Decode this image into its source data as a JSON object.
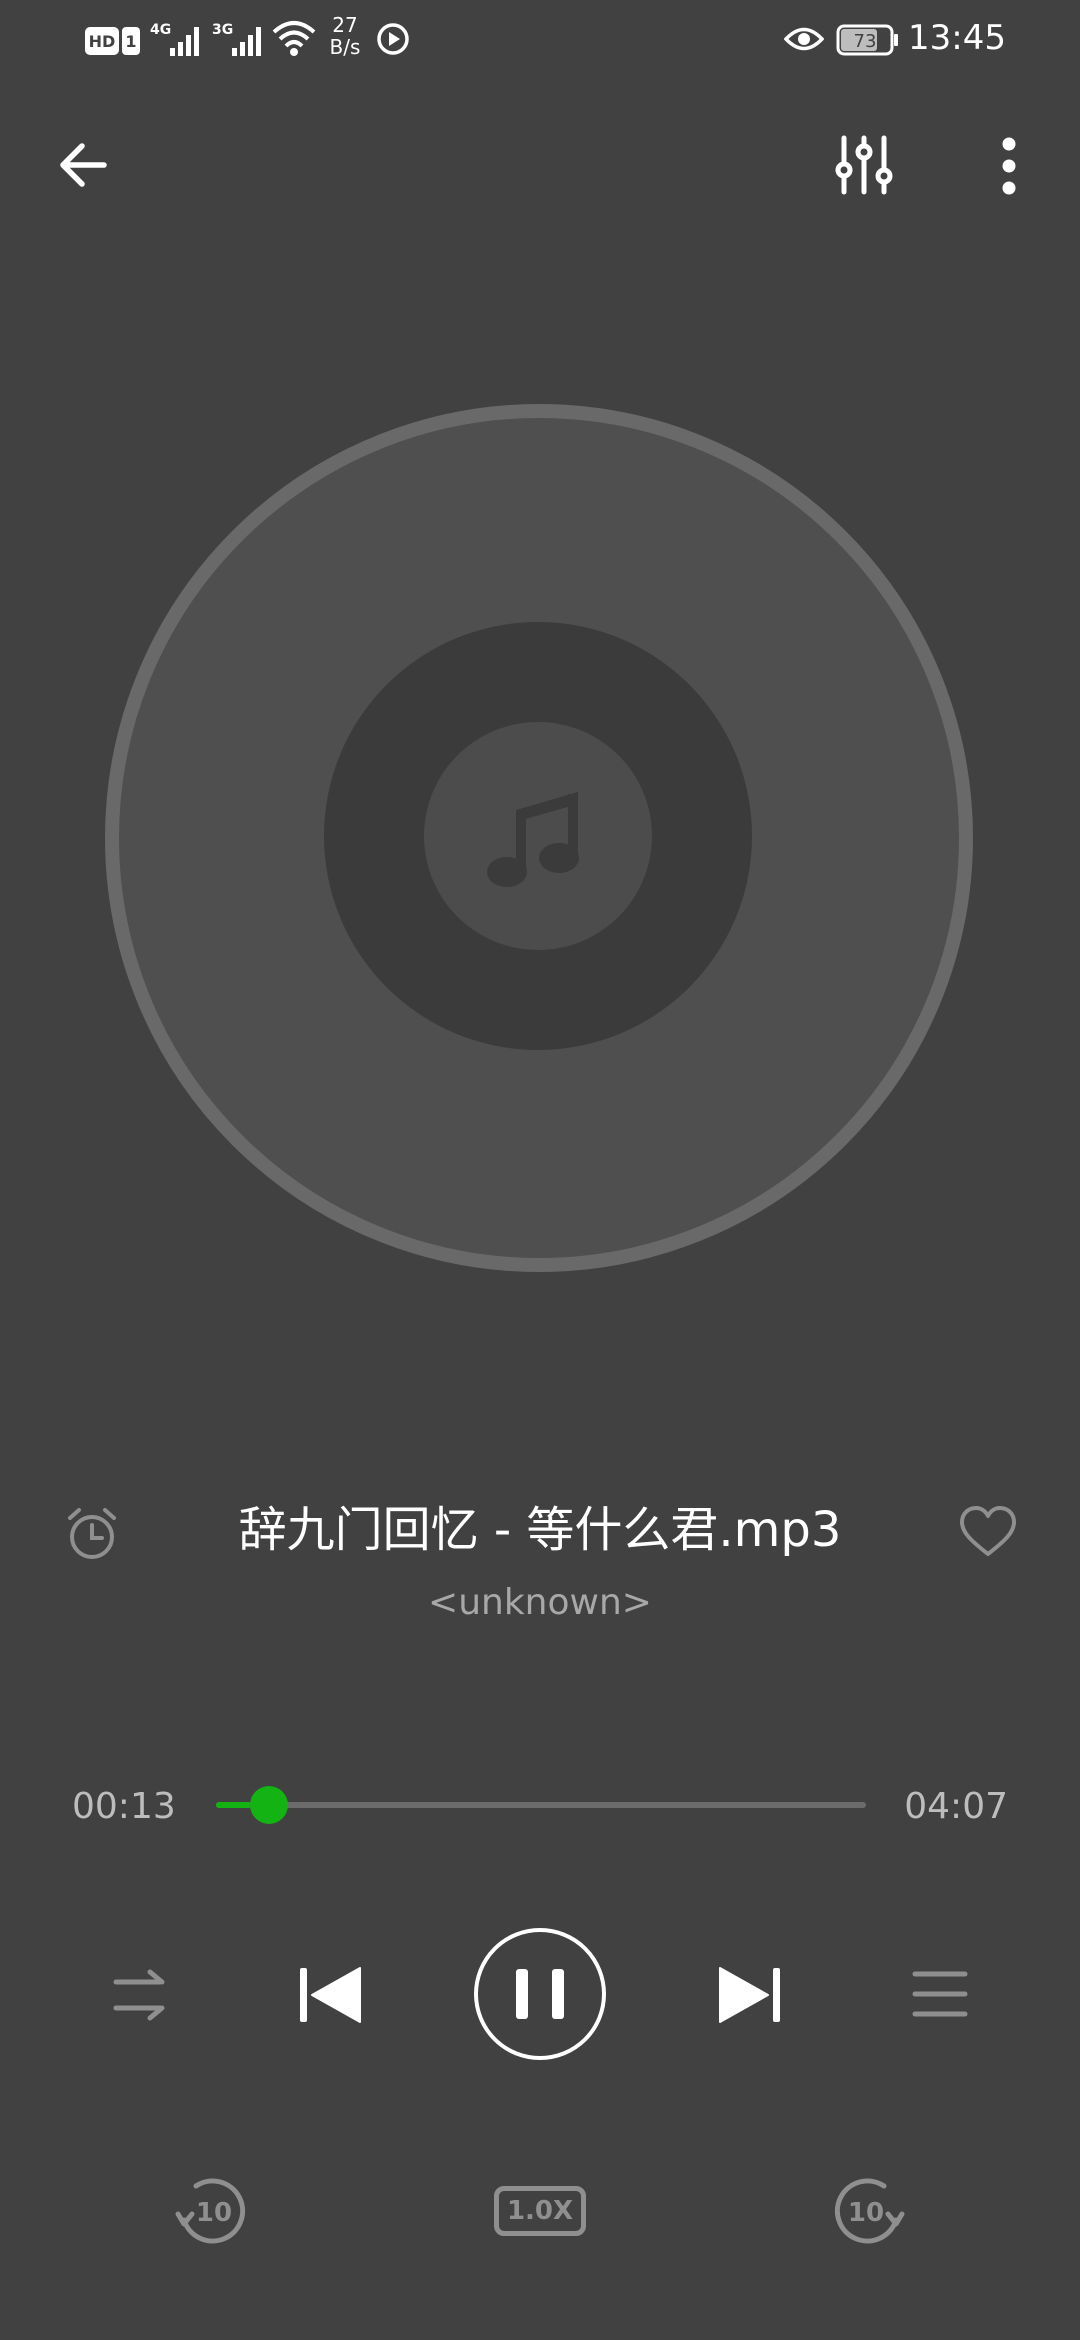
{
  "status_bar": {
    "badge_hd": "HD",
    "badge_sim": "1",
    "network_1": "4G",
    "network_2": "3G",
    "speed_value": "27",
    "speed_unit": "B/s",
    "battery": "73",
    "clock": "13:45"
  },
  "toolbar": {
    "back_icon": "arrow-left-icon",
    "equalizer_icon": "equalizer-icon",
    "more_icon": "more-vertical-icon"
  },
  "player": {
    "title": "辞九门回忆 - 等什么君.mp3",
    "artist": "<unknown>",
    "current_time": "00:13",
    "total_time": "04:07",
    "progress_fraction": 0.053,
    "speed_label": "1.0X",
    "rewind_label": "10",
    "forward_label": "10"
  },
  "colors": {
    "background": "#414141",
    "accent": "#12b312",
    "disc": "#4f4f4f",
    "disc_rim": "#696969"
  }
}
